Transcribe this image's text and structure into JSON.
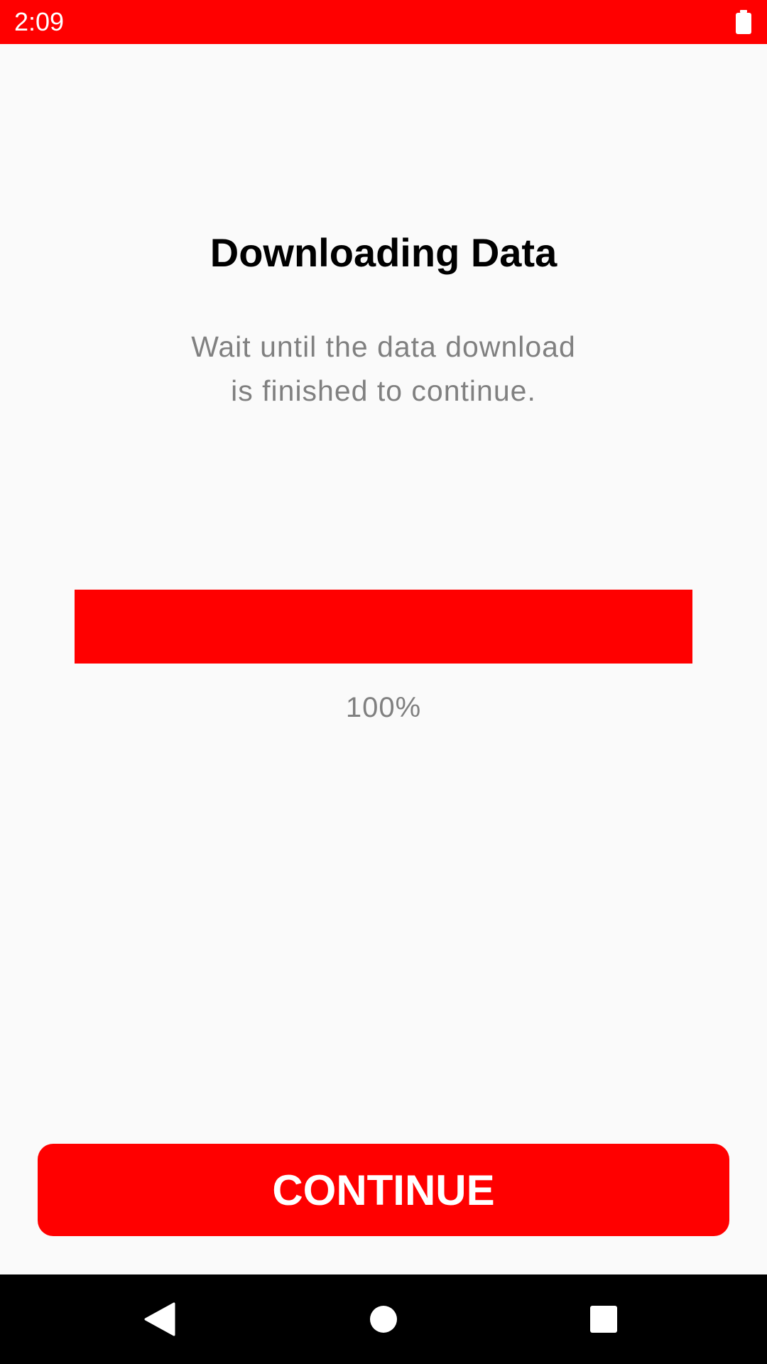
{
  "status_bar": {
    "time": "2:09",
    "icons": [
      "battery-icon"
    ],
    "color": "#ff0000"
  },
  "screen": {
    "title": "Downloading Data",
    "subtitle_line1": "Wait until the data download",
    "subtitle_line2": "is finished to continue."
  },
  "progress": {
    "value": 1.0,
    "label": "100%",
    "color": "#ff0000"
  },
  "continue_button": {
    "label": "CONTINUE",
    "color": "#ff0000"
  },
  "nav_bar": {
    "icons": [
      "back-icon",
      "home-icon",
      "recents-icon"
    ]
  }
}
